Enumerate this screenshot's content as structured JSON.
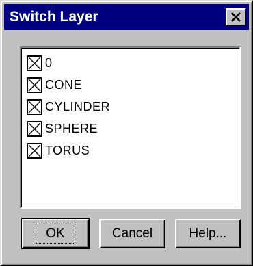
{
  "window": {
    "title": "Switch Layer",
    "close_icon": "close-x-icon"
  },
  "layers": [
    {
      "label": "0",
      "checked": true
    },
    {
      "label": "CONE",
      "checked": true
    },
    {
      "label": "CYLINDER",
      "checked": true
    },
    {
      "label": "SPHERE",
      "checked": true
    },
    {
      "label": "TORUS",
      "checked": true
    }
  ],
  "buttons": {
    "ok_label": "OK",
    "cancel_label": "Cancel",
    "help_label": "Help..."
  },
  "colors": {
    "titlebar": "#000080",
    "face": "#c0c0c0"
  }
}
